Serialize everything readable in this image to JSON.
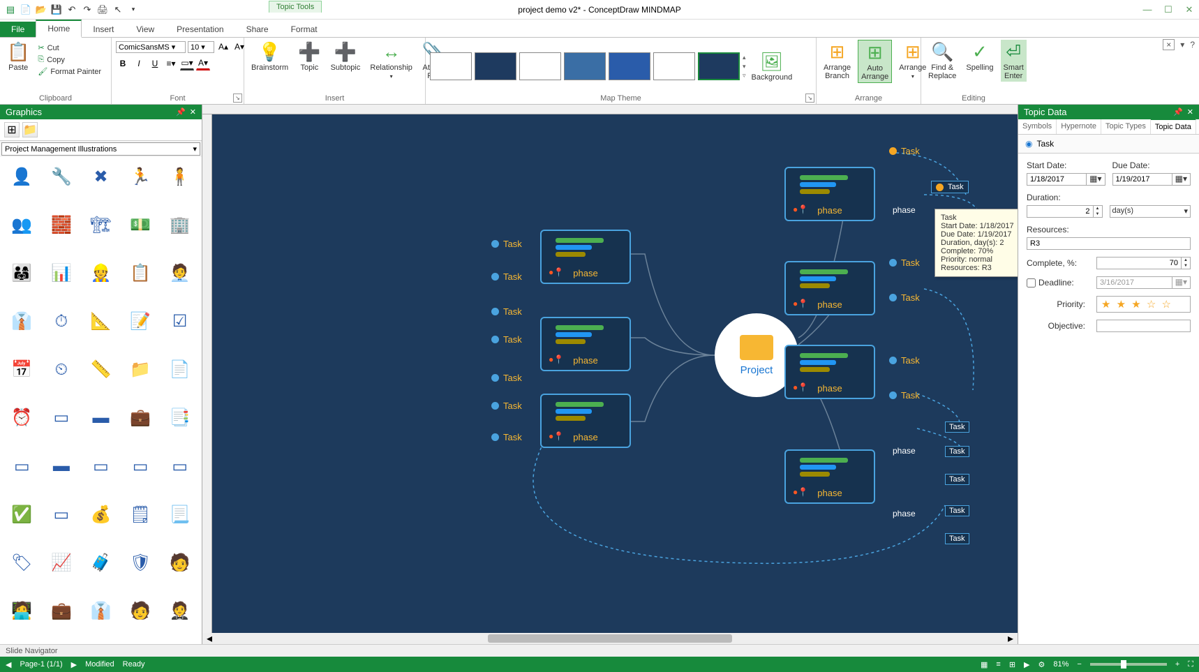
{
  "app": {
    "title": "project demo v2* - ConceptDraw MINDMAP",
    "contextual_tab": "Topic Tools"
  },
  "menu": {
    "file": "File",
    "tabs": [
      "Home",
      "Insert",
      "View",
      "Presentation",
      "Share",
      "Format"
    ],
    "active": "Home"
  },
  "ribbon": {
    "clipboard": {
      "paste": "Paste",
      "cut": "Cut",
      "copy": "Copy",
      "format_painter": "Format Painter",
      "label": "Clipboard"
    },
    "font": {
      "name": "ComicSansMS",
      "size": "10",
      "label": "Font"
    },
    "insert": {
      "brainstorm": "Brainstorm",
      "topic": "Topic",
      "subtopic": "Subtopic",
      "relationship": "Relationship",
      "attach": "Attach\nFile",
      "label": "Insert"
    },
    "map_theme": {
      "background": "Background",
      "label": "Map Theme"
    },
    "arrange": {
      "arrange_branch": "Arrange\nBranch",
      "auto_arrange": "Auto\nArrange",
      "arrange": "Arrange",
      "label": "Arrange"
    },
    "editing": {
      "find_replace": "Find &\nReplace",
      "spelling": "Spelling",
      "smart_enter": "Smart\nEnter",
      "label": "Editing"
    }
  },
  "graphics": {
    "title": "Graphics",
    "dropdown": "Project Management Illustrations",
    "icons": [
      "👤",
      "🔧",
      "✖",
      "🏃",
      "🧍",
      "👥",
      "🧱",
      "🏗",
      "💵",
      "🏢",
      "👨‍👩‍👧",
      "📊",
      "👷",
      "📋",
      "🧑‍💼",
      "👔",
      "⏱",
      "📐",
      "📝",
      "☑",
      "📅",
      "⏲",
      "📏",
      "📁",
      "📄",
      "⏰",
      "▭",
      "▬",
      "💼",
      "📑",
      "▭",
      "▬",
      "▭",
      "▭",
      "▭",
      "✅",
      "▭",
      "💰",
      "🗒",
      "📃",
      "🏷",
      "📈",
      "🧳",
      "🛡",
      "🧑",
      "🧑‍💻",
      "💼",
      "👔",
      "🧑",
      "🤵"
    ]
  },
  "mindmap": {
    "central": "Project",
    "phase_label": "phase",
    "task_label": "Task"
  },
  "tooltip": {
    "title": "Task",
    "start": "Start Date: 1/18/2017",
    "due": "Due Date: 1/19/2017",
    "duration": "Duration, day(s): 2",
    "complete": "Complete: 70%",
    "priority": "Priority: normal",
    "resources": "Resources: R3"
  },
  "topic_data": {
    "panel_title": "Topic Data",
    "tabs": [
      "Symbols",
      "Hypernote",
      "Topic Types",
      "Topic Data"
    ],
    "active_tab": "Topic Data",
    "header": "Task",
    "start_label": "Start Date:",
    "start_value": "1/18/2017",
    "due_label": "Due Date:",
    "due_value": "1/19/2017",
    "duration_label": "Duration:",
    "duration_value": "2",
    "duration_unit": "day(s)",
    "resources_label": "Resources:",
    "resources_value": "R3",
    "complete_label": "Complete, %:",
    "complete_value": "70",
    "deadline_label": "Deadline:",
    "deadline_value": "3/16/2017",
    "priority_label": "Priority:",
    "priority_stars": "★ ★ ★ ☆ ☆",
    "objective_label": "Objective:"
  },
  "slide_nav": "Slide Navigator",
  "status": {
    "page": "Page-1 (1/1)",
    "modified": "Modified",
    "ready": "Ready",
    "zoom": "81%"
  }
}
